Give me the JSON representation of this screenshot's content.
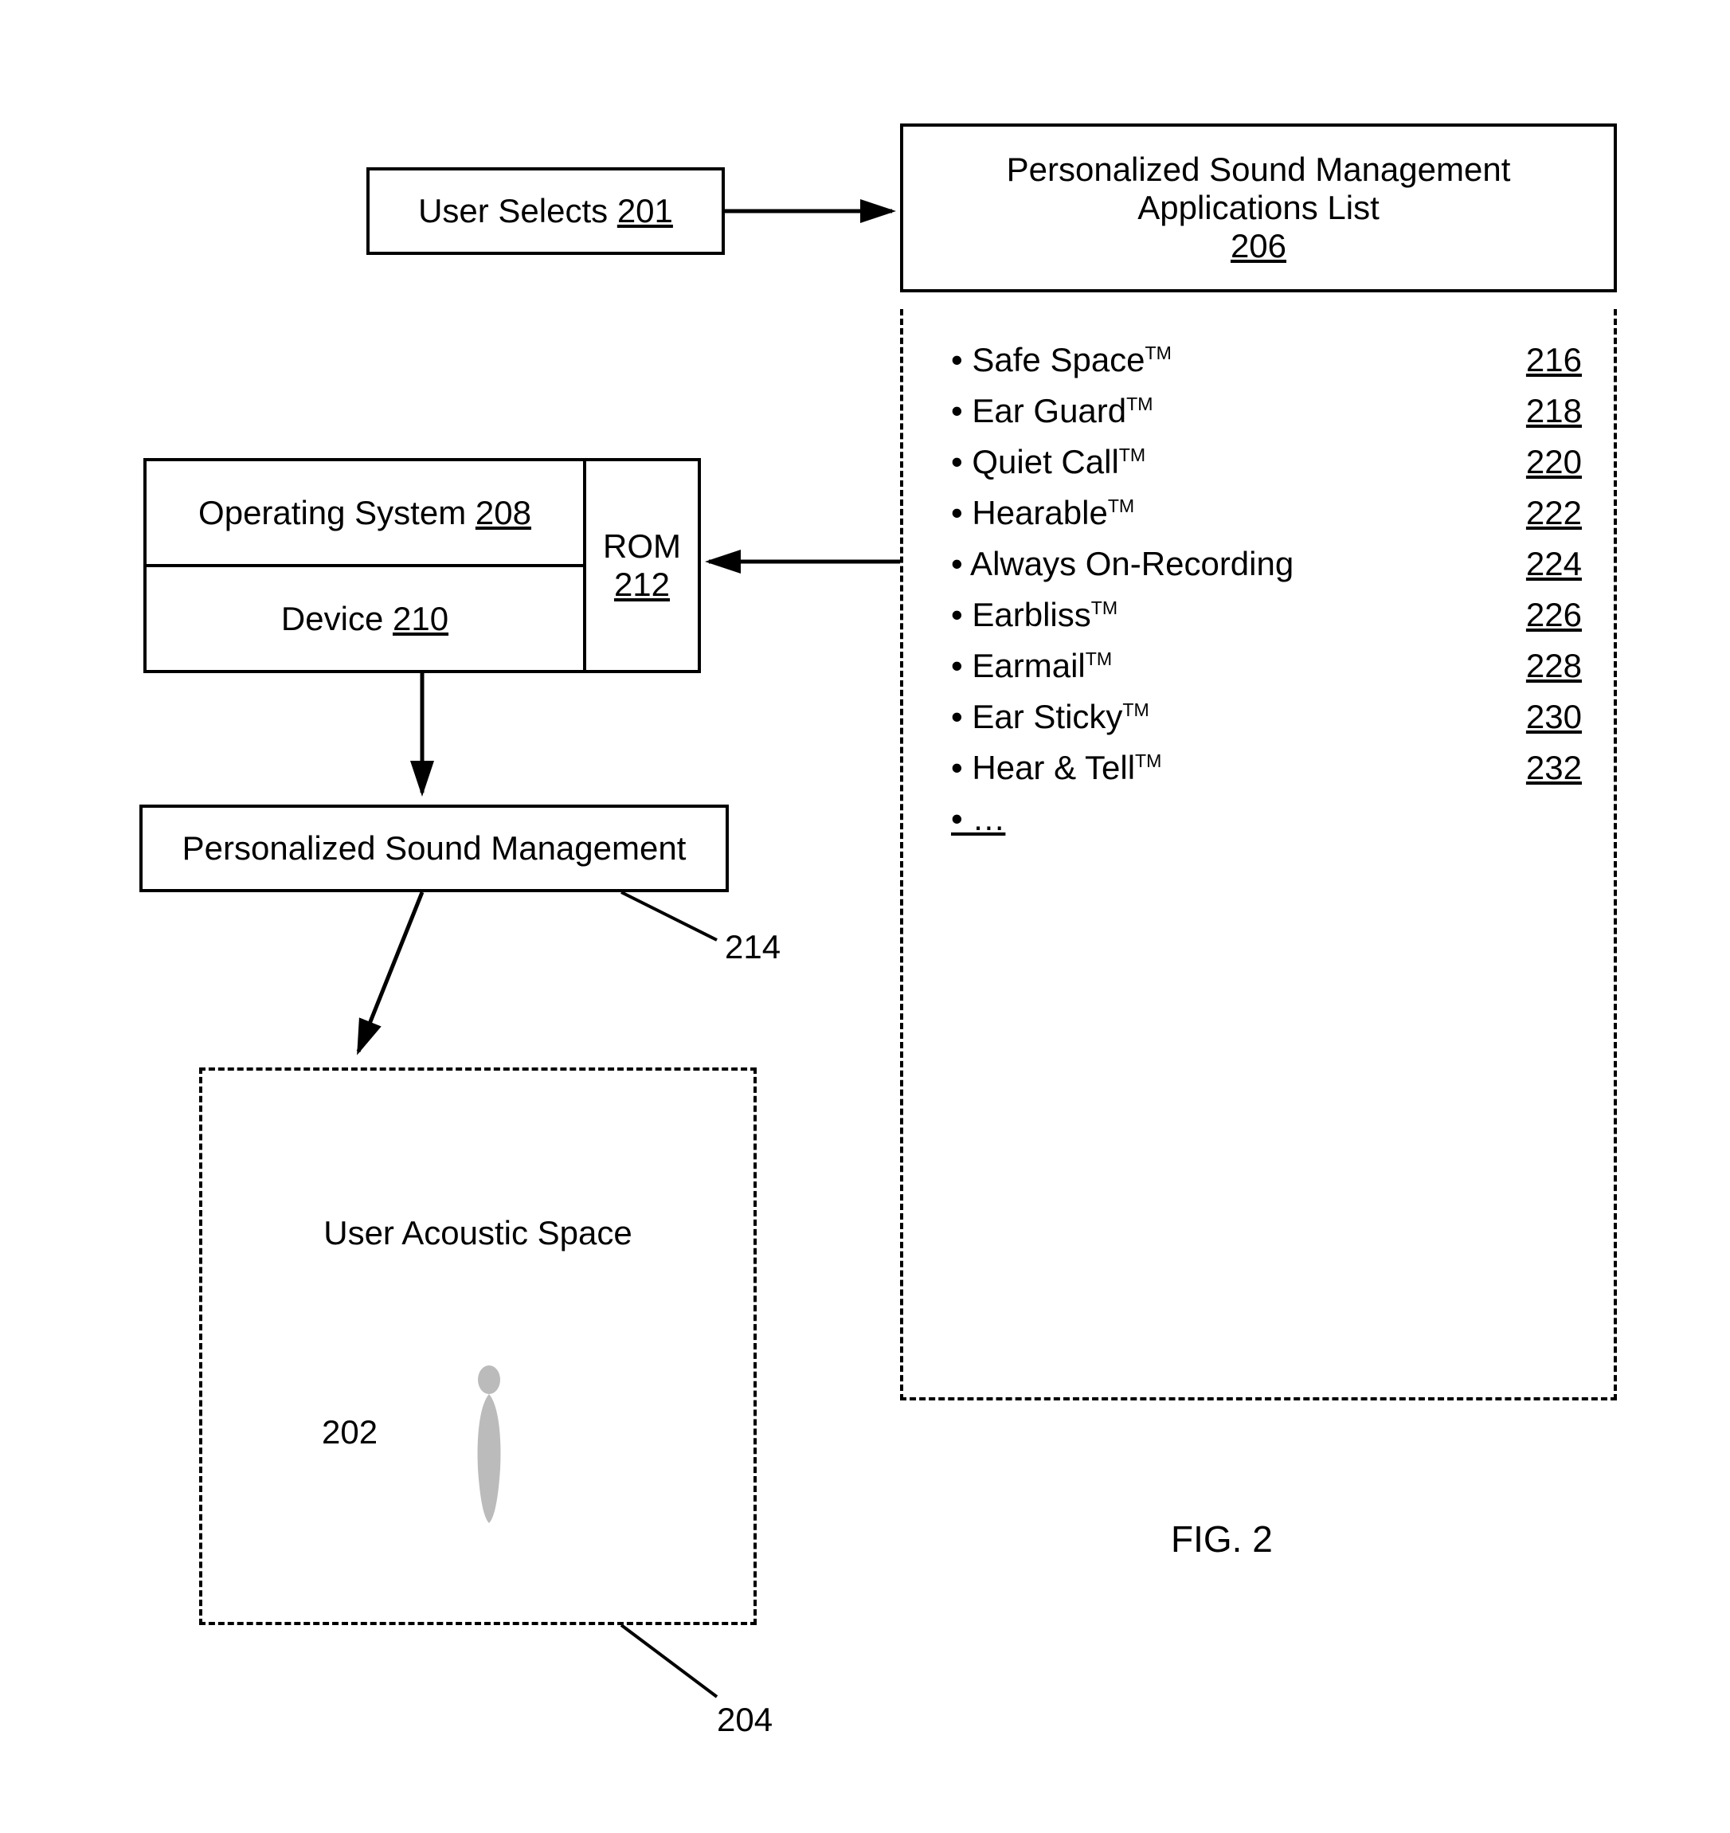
{
  "figure_caption": "FIG. 2",
  "user_selects": {
    "label": "User Selects",
    "ref": "201"
  },
  "os_box": {
    "label": "Operating System",
    "ref": "208"
  },
  "device_box": {
    "label": "Device",
    "ref": "210"
  },
  "rom_box": {
    "label": "ROM",
    "ref": "212"
  },
  "psm_box": {
    "label": "Personalized Sound Management"
  },
  "psm_callout": "214",
  "acoustic_space": {
    "label": "User Acoustic Space",
    "ref": "202",
    "callout": "204"
  },
  "apps_list": {
    "title_line1": "Personalized Sound Management",
    "title_line2": "Applications List",
    "ref": "206",
    "items": [
      {
        "name": "Safe Space",
        "tm": true,
        "ref": "216"
      },
      {
        "name": "Ear Guard",
        "tm": true,
        "ref": "218"
      },
      {
        "name": "Quiet Call",
        "tm": true,
        "ref": "220"
      },
      {
        "name": "Hearable",
        "tm": true,
        "ref": "222"
      },
      {
        "name": "Always On-Recording",
        "tm": false,
        "ref": "224"
      },
      {
        "name": "Earbliss",
        "tm": true,
        "ref": "226"
      },
      {
        "name": "Earmail",
        "tm": true,
        "ref": "228"
      },
      {
        "name": "Ear Sticky",
        "tm": true,
        "ref": "230"
      },
      {
        "name": "Hear & Tell",
        "tm": true,
        "ref": "232"
      }
    ],
    "ellipsis": "…"
  }
}
